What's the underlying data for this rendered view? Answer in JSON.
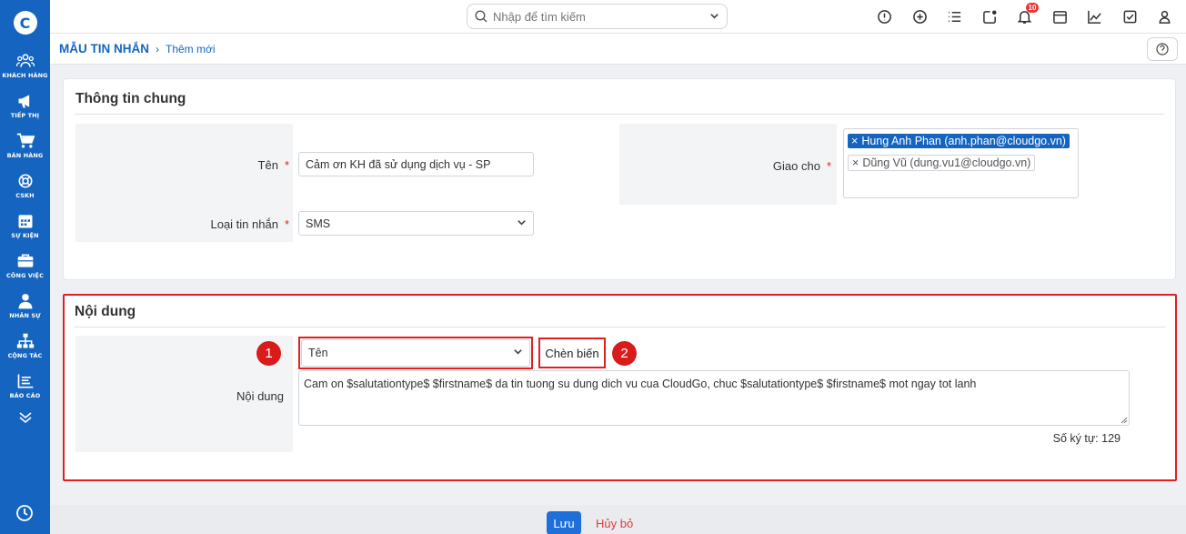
{
  "sidebar": {
    "logo": "C",
    "items": [
      {
        "label": "KHÁCH HÀNG",
        "icon": "customers-icon"
      },
      {
        "label": "TIẾP THỊ",
        "icon": "megaphone-icon"
      },
      {
        "label": "BÁN HÀNG",
        "icon": "cart-icon"
      },
      {
        "label": "CSKH",
        "icon": "support-icon"
      },
      {
        "label": "SỰ KIỆN",
        "icon": "calendar-icon"
      },
      {
        "label": "CÔNG VIỆC",
        "icon": "briefcase-icon"
      },
      {
        "label": "NHÂN SỰ",
        "icon": "person-icon"
      },
      {
        "label": "CỘNG TÁC",
        "icon": "org-chart-icon"
      },
      {
        "label": "BÁO CÁO",
        "icon": "report-icon"
      }
    ]
  },
  "search": {
    "placeholder": "Nhập để tìm kiếm"
  },
  "notifications": {
    "count": "10"
  },
  "breadcrumb": {
    "root": "MẪU TIN NHẮN",
    "separator": "›",
    "current": "Thêm mới"
  },
  "general": {
    "title": "Thông tin chung",
    "name_label": "Tên",
    "name_value": "Cảm ơn KH đã sử dụng dịch vụ - SP",
    "type_label": "Loại tin nhắn",
    "type_value": "SMS",
    "assign_label": "Giao cho",
    "assignees": [
      {
        "text": "Hung Anh Phan (anh.phan@cloudgo.vn)",
        "selected": true
      },
      {
        "text": "Dũng Vũ (dung.vu1@cloudgo.vn)",
        "selected": false
      }
    ],
    "required_mark": "*"
  },
  "content": {
    "title": "Nội dung",
    "label": "Nội dung",
    "variable_value": "Tên",
    "insert_label": "Chèn biến",
    "marker1": "1",
    "marker2": "2",
    "message": "Cam on $salutationtype$ $firstname$ da tin tuong su dung dich vu cua CloudGo, chuc $salutationtype$ $firstname$ mot ngay tot lanh",
    "char_count": "Số ký tự: 129"
  },
  "footer": {
    "save_label": "Lưu",
    "cancel_label": "Hủy bỏ"
  },
  "colors": {
    "brand": "#1565c0",
    "highlight": "#e02020"
  }
}
